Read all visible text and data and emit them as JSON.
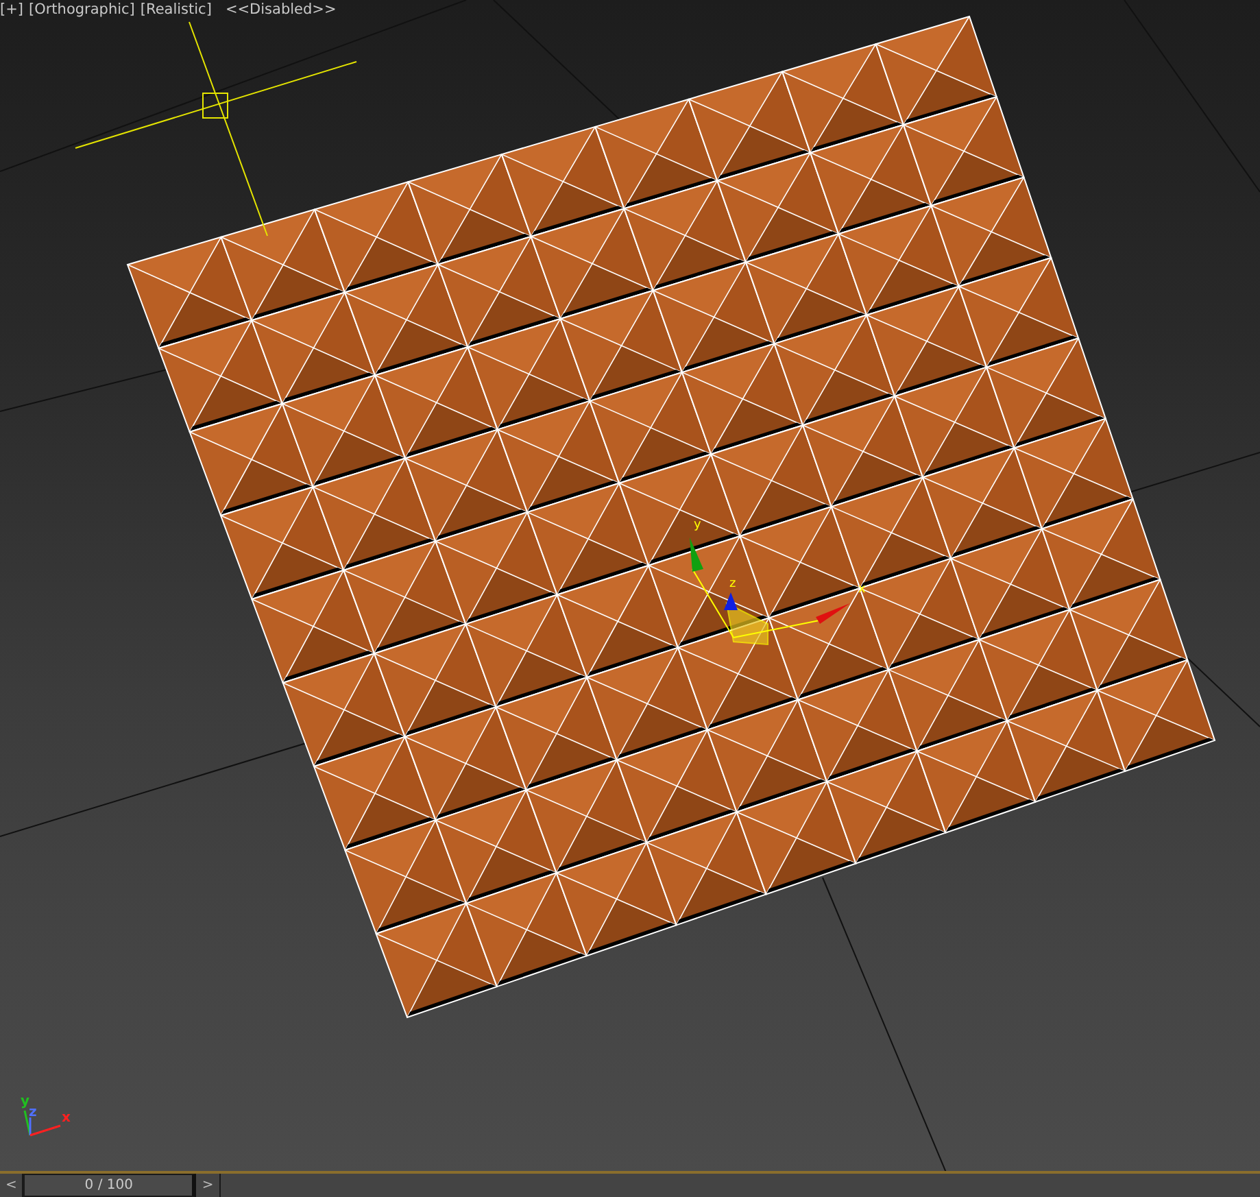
{
  "viewport": {
    "labels": [
      "[+]",
      "[Orthographic]",
      "[Realistic]",
      "<<Disabled>>"
    ],
    "gizmo_axes": [
      {
        "kind": "y",
        "label": "y"
      },
      {
        "kind": "z",
        "label": "z"
      },
      {
        "kind": "x",
        "label": "x"
      }
    ],
    "corner_axes": [
      {
        "kind": "y",
        "label": "y"
      },
      {
        "kind": "z",
        "label": "z"
      },
      {
        "kind": "x",
        "label": "x"
      }
    ]
  },
  "time_slider": {
    "prev": "<",
    "frame": "0 / 100",
    "next": ">"
  }
}
